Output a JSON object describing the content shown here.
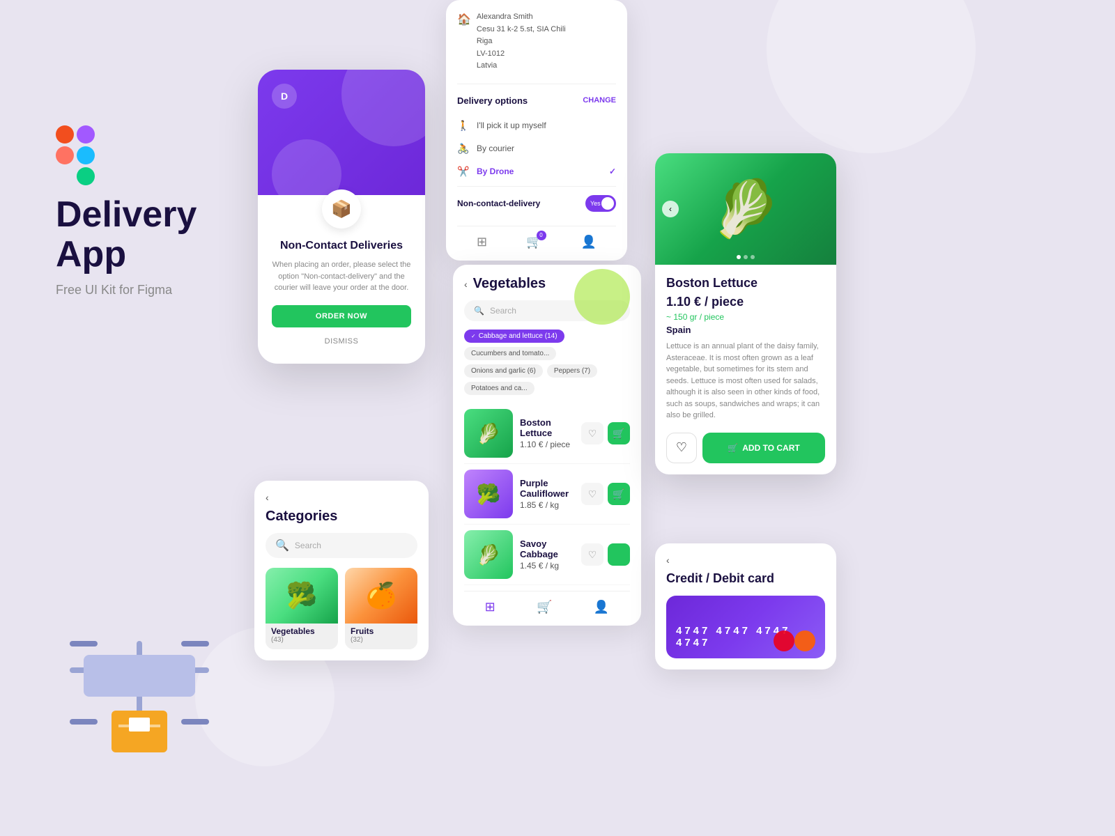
{
  "branding": {
    "title_line1": "Delivery",
    "title_line2": "App",
    "subtitle": "Free UI Kit for Figma",
    "logo_letter": "D"
  },
  "non_contact_card": {
    "title": "Non-Contact Deliveries",
    "description": "When placing an order, please select the option \"Non-contact-delivery\" and the courier will leave your order at the door.",
    "order_btn": "ORDER NOW",
    "dismiss_btn": "DISMISS"
  },
  "delivery_options": {
    "address": {
      "name": "Alexandra Smith",
      "line1": "Cesu 31 k-2 5.st, SIA Chili",
      "line2": "Riga",
      "line3": "LV-1012",
      "line4": "Latvia"
    },
    "title": "Delivery options",
    "change_label": "CHANGE",
    "options": [
      {
        "icon": "🚶",
        "label": "I'll pick it up myself",
        "active": false
      },
      {
        "icon": "🚴",
        "label": "By courier",
        "active": false
      },
      {
        "icon": "✂️",
        "label": "By Drone",
        "active": true
      }
    ],
    "non_contact": {
      "label": "Non-contact-delivery",
      "toggle_label": "Yes"
    }
  },
  "vegetables_search": {
    "back_arrow": "‹",
    "title": "Vegetables",
    "search_placeholder": "Search",
    "chips": [
      {
        "label": "Cabbage and lettuce (14)",
        "active": true
      },
      {
        "label": "Cucumbers and tomato...",
        "active": false
      },
      {
        "label": "Onions and garlic (6)",
        "active": false
      },
      {
        "label": "Peppers (7)",
        "active": false
      },
      {
        "label": "Potatoes and ca...",
        "active": false
      }
    ],
    "products": [
      {
        "name": "Boston Lettuce",
        "price": "1.10 € / piece",
        "emoji": "🥬"
      },
      {
        "name": "Purple Cauliflower",
        "price": "1.85 € / kg",
        "emoji": "🥦"
      },
      {
        "name": "Savoy Cabbage",
        "price": "1.45 € / kg",
        "emoji": "🥬"
      }
    ]
  },
  "categories": {
    "back_arrow": "‹",
    "title": "Categories",
    "search_placeholder": "Search",
    "items": [
      {
        "name": "Vegetables",
        "count": "(43)",
        "emoji": "🥦"
      },
      {
        "name": "Fruits",
        "count": "(32)",
        "emoji": "🍊"
      }
    ]
  },
  "product_detail": {
    "name": "Boston Lettuce",
    "price": "1.10 € / piece",
    "size": "~ 150 gr / piece",
    "origin": "Spain",
    "description": "Lettuce is an annual plant of the daisy family, Asteraceae. It is most often grown as a leaf vegetable, but sometimes for its stem and seeds. Lettuce is most often used for salads, although it is also seen in other kinds of food, such as soups, sandwiches and wraps; it can also be grilled.",
    "add_to_cart_label": "ADD TO CART",
    "nav_arrow": "‹",
    "dots": [
      true,
      false,
      false
    ]
  },
  "credit_card": {
    "back_arrow": "‹",
    "title": "Credit / Debit card",
    "number": "4747  4747  4747  4747"
  }
}
